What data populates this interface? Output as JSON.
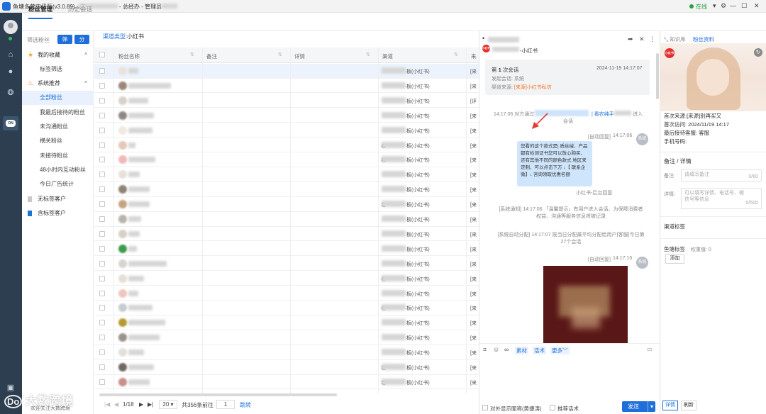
{
  "window": {
    "title_prefix": "鱼塘多营中级版(v3.0.89) - 广",
    "title_mid": "- 总经办 - 管理员 -",
    "status": "在线",
    "controls": [
      "▾",
      "⚙",
      "—",
      "☐",
      "✕"
    ]
  },
  "main_tabs": [
    {
      "label": "粉丝管理",
      "active": true
    },
    {
      "label": "历史会话",
      "active": false
    }
  ],
  "sidebar": {
    "filter_label": "筛选粉丝",
    "filter_button": "筛选",
    "analyze_button": "分析",
    "groups": [
      {
        "label": "我的收藏",
        "icon": "star-icon",
        "expanded": true,
        "items": [
          "标签筛选"
        ]
      },
      {
        "label": "系统推荐",
        "icon": "fire-icon",
        "expanded": true,
        "items": [
          "全部粉丝",
          "我最后接待的粉丝",
          "未沟通粉丝",
          "横关粉丝",
          "未接待粉丝",
          "48小时内互动粉丝",
          "今日广告统计"
        ]
      }
    ],
    "active_item": "全部粉丝",
    "extra": [
      {
        "label": "无标签客户",
        "icon": "bookmark-icon",
        "color": "#c8c8c8"
      },
      {
        "label": "含标签客户",
        "icon": "bookmark-icon",
        "color": "#1e6fd9"
      }
    ]
  },
  "filter": {
    "label": "渠道类型:",
    "value": "小红书"
  },
  "table": {
    "columns": [
      "粉丝名称",
      "备注",
      "详情",
      "渠道",
      "来"
    ],
    "source_suffix": "板(小红书)",
    "source_prefix": "老",
    "last_col_values": [
      "[来",
      "[来",
      "[评",
      "[来",
      "[来",
      "[来",
      "[来",
      "[来",
      "[来",
      "[来",
      "[来",
      "[来",
      "[来",
      "[来",
      "[来",
      "[来",
      "[来",
      "[来",
      "[来",
      "[来",
      "[来",
      "[来"
    ]
  },
  "pager": {
    "current": "1/18",
    "page_size": "20",
    "total": "共356条",
    "goto_label": "前往",
    "goto_value": "1",
    "jump": "跳转"
  },
  "chat": {
    "title_suffix": "-小红书",
    "title_prefix_mark": "•",
    "session": {
      "count_prefix": "第",
      "count": "1",
      "count_suffix": "次会话",
      "time": "2024-11-19 14:17:07",
      "initiator": "发起会话: 系统",
      "channel_label": "渠道来源:",
      "channel_value": "[来源]小红书私信"
    },
    "enter_msg_time": "14:17:06 对方通过",
    "enter_msg_mid": "| 看农纯手",
    "enter_msg_end": "进入",
    "enter_msg_tail": "会话",
    "auto_reply_label": "[自动回复]",
    "auto_reply_time": "14:17:06",
    "bubble_text": "您看的这个款式是| 质丝绒、产品都有检测证书您可以放心购买、还有其他不同的颜色款式 地区来定制、可以点击下方 ↓【 联系企微】↓ 咨询领取优惠名额",
    "bubble_footer": "小红书-后台回复",
    "system_avatar": "系统",
    "sys_notice_1": "[系统通知] 14:17:06 「温馨提示」有用户进入会话、为保障消费者权益、沟通等服务信息将被记录",
    "sys_notice_2": "[系统自动分配] 14:17:07 按当日分配最平均分配给用户[客服]今日第27个会话",
    "auto_reply_time_2": "14:17:15",
    "toolbar": {
      "material": "素材",
      "script": "话术",
      "more": "更多"
    },
    "show_nickname": "对外显示昵称(黄捷涛)",
    "recommend": "推荐话术",
    "send": "发送"
  },
  "right_panel": {
    "tabs": [
      {
        "label": "知识库",
        "active": false
      },
      {
        "label": "粉丝资料",
        "active": true
      }
    ],
    "badge": "小红书",
    "first_source_label": "首次来源:",
    "first_source_value": "[来源]别再买又",
    "first_visit": "首次访问: 2024/11/19 14:17",
    "last_receptionist": "最后接待客服: 客服",
    "phone": "手机号码:",
    "notes_title": "备注 / 详情",
    "notes_label": "备注:",
    "notes_placeholder": "请填写备注",
    "notes_count": "0/60",
    "details_label": "详情:",
    "details_placeholder": "可以填写详情、电话号、微信号等信息",
    "details_count": "0/500",
    "channel_tag": "渠道标签",
    "fish_tag_label": "鱼塘标签",
    "fish_tag_weight": "权重值: 0",
    "add_button": "添加",
    "bottom_details": "详情",
    "bottom_refresh": "刷新"
  },
  "watermark": {
    "main": "大数跨境",
    "sub": "欢迎关注大数跨境"
  },
  "colors": {
    "accent": "#1e6fd9",
    "rail": "#2c3e50",
    "online": "#27a243",
    "xhs": "#e3302f"
  }
}
